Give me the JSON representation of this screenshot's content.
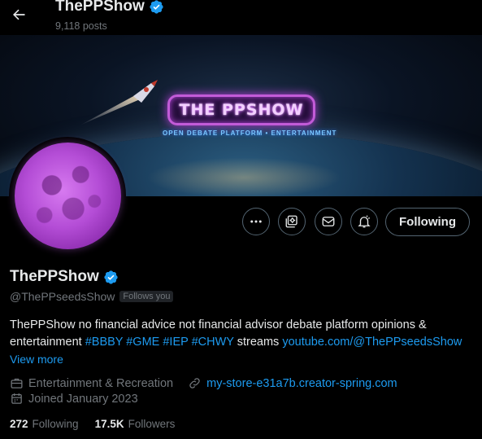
{
  "header": {
    "title": "ThePPShow",
    "post_count": "9,118 posts"
  },
  "banner": {
    "logo_text": "THE PPSHOW",
    "logo_subtitle": "OPEN DEBATE PLATFORM • ENTERTAINMENT"
  },
  "actions": {
    "follow_label": "Following"
  },
  "profile": {
    "name": "ThePPShow",
    "handle": "@ThePPseedsShow",
    "follows_you": "Follows you",
    "bio_text": "ThePPShow no financial advice not financial advisor debate platform opinions & entertainment",
    "hashtags": [
      "#BBBY",
      "#GME",
      "#IEP",
      "#CHWY"
    ],
    "bio_streams": "streams",
    "bio_link": "youtube.com/@ThePPseedsShow",
    "view_more": "View more",
    "category": "Entertainment & Recreation",
    "website": "my-store-e31a7b.creator-spring.com",
    "joined": "Joined January 2023"
  },
  "stats": {
    "following_count": "272",
    "following_label": "Following",
    "followers_count": "17.5K",
    "followers_label": "Followers"
  },
  "colors": {
    "accent": "#1d9bf0",
    "secondary_text": "#71767b",
    "primary_text": "#e7e9ea",
    "border": "#536471",
    "verified": "#1d9bf0",
    "moon": "#b44dd6"
  },
  "icons": [
    "back-arrow-icon",
    "verified-badge-icon",
    "more-icon",
    "subscribe-icon",
    "message-icon",
    "notification-bell-icon",
    "briefcase-icon",
    "link-icon",
    "calendar-icon"
  ]
}
